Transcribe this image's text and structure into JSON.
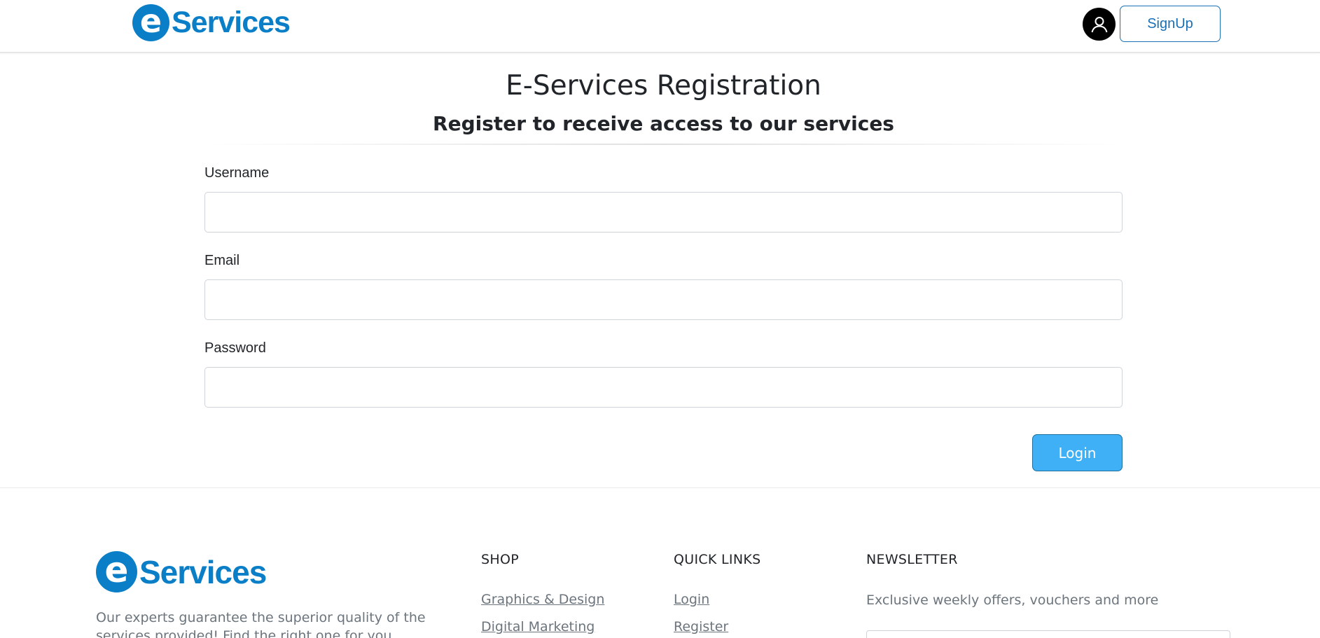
{
  "header": {
    "logo_letter": "e",
    "logo_text": "Services",
    "signup_label": "SignUp",
    "avatar_icon": "user-icon"
  },
  "main": {
    "title": "E-Services Registration",
    "subtitle": "Register to receive access to our services",
    "fields": [
      {
        "label": "Username",
        "value": "",
        "placeholder": ""
      },
      {
        "label": "Email",
        "value": "",
        "placeholder": ""
      },
      {
        "label": "Password",
        "value": "",
        "placeholder": ""
      }
    ],
    "submit_label": "Login"
  },
  "footer": {
    "logo_letter": "e",
    "logo_text": "Services",
    "description": "Our experts guarantee the superior quality of the services provided! Find the right one for you.",
    "columns": [
      {
        "heading": "SHOP",
        "links": [
          "Graphics & Design",
          "Digital Marketing"
        ]
      },
      {
        "heading": "QUICK LINKS",
        "links": [
          "Login",
          "Register"
        ]
      },
      {
        "heading": "NEWSLETTER",
        "text": "Exclusive weekly offers, vouchers and more"
      }
    ]
  },
  "colors": {
    "brand": "#0a7fc7",
    "signup_border": "#1a6fb5",
    "login_button": "#3fb0f5",
    "muted_text": "#6c757d"
  }
}
